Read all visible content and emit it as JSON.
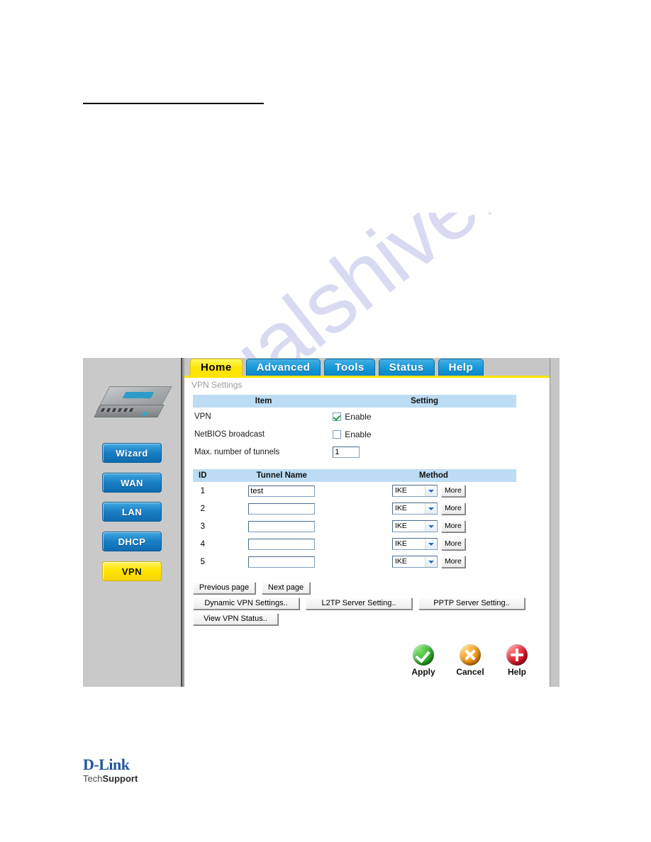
{
  "watermark": {
    "text": "manualshive.com"
  },
  "router_ui": {
    "tabs": [
      {
        "label": "Home",
        "active": true
      },
      {
        "label": "Advanced",
        "active": false
      },
      {
        "label": "Tools",
        "active": false
      },
      {
        "label": "Status",
        "active": false
      },
      {
        "label": "Help",
        "active": false
      }
    ],
    "page_title": "VPN Settings",
    "sidebar": {
      "items": [
        {
          "label": "Wizard",
          "state": "normal"
        },
        {
          "label": "WAN",
          "state": "normal"
        },
        {
          "label": "LAN",
          "state": "normal"
        },
        {
          "label": "DHCP",
          "state": "normal"
        },
        {
          "label": "VPN",
          "state": "selected"
        }
      ]
    },
    "settings_table": {
      "headers": {
        "item": "Item",
        "setting": "Setting"
      },
      "rows": [
        {
          "item": "VPN",
          "control": "checkbox",
          "checked": true,
          "label": "Enable"
        },
        {
          "item": "NetBIOS broadcast",
          "control": "checkbox",
          "checked": false,
          "label": "Enable"
        },
        {
          "item": "Max. number of tunnels",
          "control": "text",
          "value": "1"
        }
      ]
    },
    "tunnel_table": {
      "headers": {
        "id": "ID",
        "name": "Tunnel Name",
        "method": "Method"
      },
      "rows": [
        {
          "id": "1",
          "name": "test",
          "method": "IKE",
          "more": "More"
        },
        {
          "id": "2",
          "name": "",
          "method": "IKE",
          "more": "More"
        },
        {
          "id": "3",
          "name": "",
          "method": "IKE",
          "more": "More"
        },
        {
          "id": "4",
          "name": "",
          "method": "IKE",
          "more": "More"
        },
        {
          "id": "5",
          "name": "",
          "method": "IKE",
          "more": "More"
        }
      ]
    },
    "buttons": {
      "previous_page": "Previous page",
      "next_page": "Next page",
      "dynamic_vpn": "Dynamic VPN Settings..",
      "l2tp_server": "L2TP Server Setting..",
      "pptp_server": "PPTP Server Setting..",
      "view_status": "View VPN Status.."
    },
    "actions": [
      {
        "label": "Apply",
        "icon": "green-check-icon"
      },
      {
        "label": "Cancel",
        "icon": "orange-x-icon"
      },
      {
        "label": "Help",
        "icon": "red-plus-icon"
      }
    ]
  },
  "footer": {
    "brand": "D-Link",
    "tech": "Tech",
    "support": "Support"
  },
  "colors": {
    "tab_active": "#ffe400",
    "tab_inactive": "#179ad9",
    "table_header": "#bcdcf4",
    "sidebar_selected": "#ffe400",
    "watermark": "#b9bde8"
  }
}
